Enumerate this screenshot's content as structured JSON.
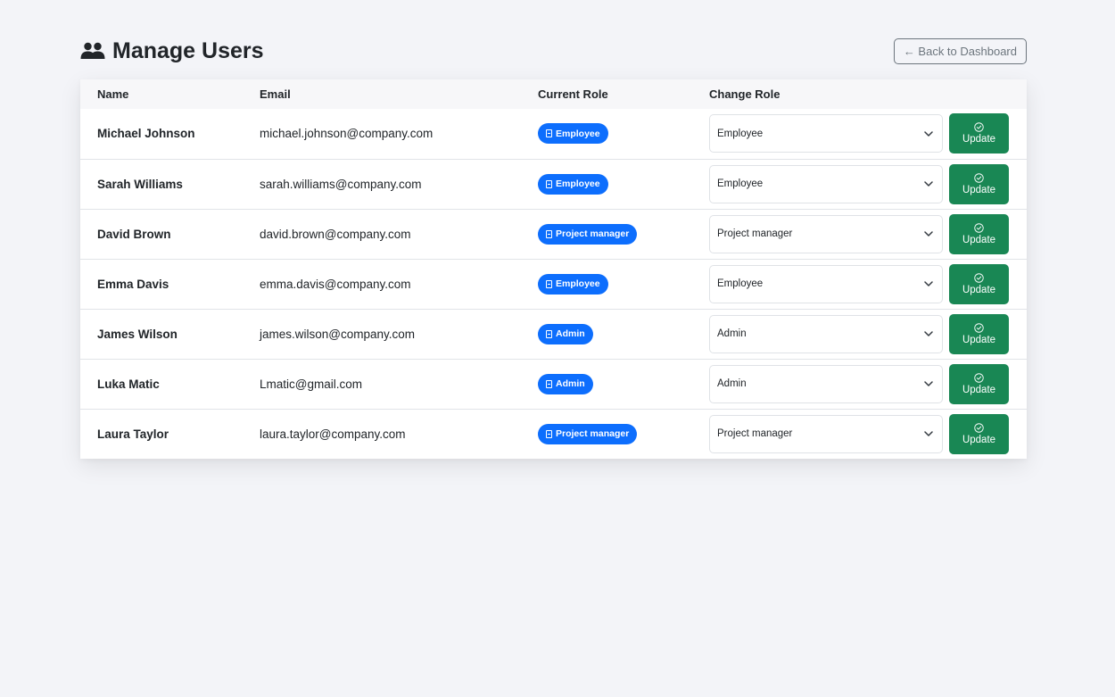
{
  "header": {
    "title": "Manage Users",
    "back_label": "← Back to Dashboard"
  },
  "table": {
    "columns": [
      "Name",
      "Email",
      "Current Role",
      "Change Role",
      ""
    ],
    "update_label": "Update",
    "rows": [
      {
        "name": "Michael Johnson",
        "email": "michael.johnson@company.com",
        "role": "Employee",
        "selected": "Employee"
      },
      {
        "name": "Sarah Williams",
        "email": "sarah.williams@company.com",
        "role": "Employee",
        "selected": "Employee"
      },
      {
        "name": "David Brown",
        "email": "david.brown@company.com",
        "role": "Project manager",
        "selected": "Project manager"
      },
      {
        "name": "Emma Davis",
        "email": "emma.davis@company.com",
        "role": "Employee",
        "selected": "Employee"
      },
      {
        "name": "James Wilson",
        "email": "james.wilson@company.com",
        "role": "Admin",
        "selected": "Admin"
      },
      {
        "name": "Luka Matic",
        "email": "Lmatic@gmail.com",
        "role": "Admin",
        "selected": "Admin"
      },
      {
        "name": "Laura Taylor",
        "email": "laura.taylor@company.com",
        "role": "Project manager",
        "selected": "Project manager"
      }
    ]
  },
  "colors": {
    "badge": "#0d6efd",
    "update_button": "#198754",
    "background": "#f3f4f8"
  },
  "icons": {
    "title": "users-icon",
    "badge": "id-badge-icon",
    "select": "chevron-down-icon",
    "update": "check-circle-icon"
  }
}
